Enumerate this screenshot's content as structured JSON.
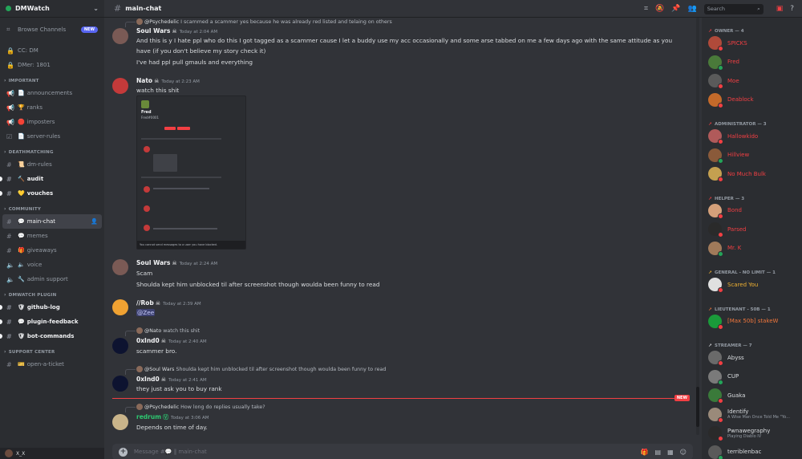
{
  "server": {
    "name": "DMWatch"
  },
  "sidebar": {
    "browse": {
      "label": "Browse Channels",
      "badge": "NEW"
    },
    "top_channels": [
      "CC: DM",
      "DMer: 1801"
    ],
    "categories": [
      {
        "name": "IMPORTANT",
        "channels": [
          {
            "label": "announcements",
            "emoji": "📄"
          },
          {
            "label": "ranks",
            "emoji": "🏆"
          },
          {
            "label": "imposters",
            "emoji": "🛑"
          },
          {
            "label": "server-rules",
            "emoji": "📄"
          }
        ]
      },
      {
        "name": "DEATHMATCHING",
        "channels": [
          {
            "label": "dm-rules",
            "emoji": "📜"
          },
          {
            "label": "audit",
            "emoji": "🔨"
          },
          {
            "label": "vouches",
            "emoji": "💛"
          }
        ]
      },
      {
        "name": "COMMUNITY",
        "channels": [
          {
            "label": "main-chat",
            "emoji": "💬"
          },
          {
            "label": "memes",
            "emoji": "💬"
          },
          {
            "label": "giveaways",
            "emoji": "🎁"
          },
          {
            "label": "voice",
            "emoji": "🔈"
          },
          {
            "label": "admin support",
            "emoji": "🔧"
          }
        ]
      },
      {
        "name": "DMWATCH PLUGIN",
        "channels": [
          {
            "label": "github-log",
            "emoji": "🛡"
          },
          {
            "label": "plugin-feedback",
            "emoji": "💬"
          },
          {
            "label": "bot-commands",
            "emoji": "🛡"
          }
        ]
      },
      {
        "name": "SUPPORT CENTER",
        "channels": [
          {
            "label": "open-a-ticket",
            "emoji": "🎫"
          }
        ]
      }
    ],
    "user": {
      "name": "X_X"
    }
  },
  "topbar": {
    "channel": "main-chat",
    "search_placeholder": "Search"
  },
  "messages": {
    "m1": {
      "reply_user": "@Psychedelic",
      "reply_text": "I scammed a scammer yes because he was already red listed and telaing on others",
      "author": "Soul Wars",
      "time": "Today at 2:04 AM",
      "lines": [
        "And this is y I hate ppl who do this I got tagged as a scammer cause I let a buddy use my acc occasionally and some arse tabbed on me a few days ago with the same attitude as you",
        "have (if you don't believe my story check it)",
        "I've had ppl pull gmauls and everything"
      ]
    },
    "m2": {
      "author": "Nato",
      "time": "Today at 2:23 AM",
      "text": "watch this shit",
      "embed": {
        "name1": "Fred",
        "name2": "Fred#0001",
        "foot": "You cannot send messages to a user you have blocked."
      }
    },
    "m3": {
      "author": "Soul Wars",
      "time": "Today at 2:24 AM",
      "lines": [
        "Scam",
        "Shoulda kept him unblocked til after screenshot though woulda been funny to read"
      ]
    },
    "m4": {
      "author": "//Rob",
      "time": "Today at 2:39 AM",
      "mention": "@Zee"
    },
    "m5": {
      "reply_user": "@Nato",
      "reply_text": "watch this shit",
      "author": "0xInd0",
      "time": "Today at 2:40 AM",
      "text": "scammer bro."
    },
    "m6": {
      "reply_user": "@Soul Wars",
      "reply_text": "Shoulda kept him unblocked til after screenshot though woulda been funny to read",
      "author": "0xInd0",
      "time": "Today at 2:41 AM",
      "text": "they just ask you to buy rank"
    },
    "divider_label": "NEW",
    "m7": {
      "reply_user": "@Psychedelic",
      "reply_text": "How long do replies usually take?",
      "author": "redrum",
      "time": "Today at 3:06 AM",
      "text": "Depends on time of day."
    }
  },
  "composer": {
    "placeholder": "Message #💬 ‖ main-chat"
  },
  "members": {
    "roles": [
      {
        "title": "OWNER — 4",
        "color": "#f23f43",
        "items": [
          {
            "name": "SPICKS",
            "color": "#f23f43"
          },
          {
            "name": "Fred",
            "color": "#f23f43"
          },
          {
            "name": "Moe",
            "color": "#f23f43"
          },
          {
            "name": "Deablock",
            "color": "#f23f43"
          }
        ]
      },
      {
        "title": "ADMINISTRATOR — 3",
        "color": "#f23f43",
        "items": [
          {
            "name": "Hallowkido",
            "color": "#f23f43"
          },
          {
            "name": "Hillview",
            "color": "#f23f43"
          },
          {
            "name": "No Much Bulk",
            "color": "#f23f43"
          }
        ]
      },
      {
        "title": "HELPER — 3",
        "color": "#f23f43",
        "items": [
          {
            "name": "Bond",
            "color": "#f23f43"
          },
          {
            "name": "Parsed",
            "color": "#f23f43"
          },
          {
            "name": "Mr. K",
            "color": "#f23f43"
          }
        ]
      },
      {
        "title": "GENERAL - NO LIMIT — 1",
        "color": "#f0b232",
        "items": [
          {
            "name": "Scared You",
            "color": "#f0b232"
          }
        ]
      },
      {
        "title": "LIEUTENANT - 50B — 1",
        "color": "#f0763c",
        "items": [
          {
            "name": "[Max 50b] stakeW",
            "color": "#f0763c"
          }
        ]
      },
      {
        "title": "STREAMER — 7",
        "color": "#dbdee1",
        "items": [
          {
            "name": "Abyss",
            "color": "#dbdee1"
          },
          {
            "name": "CUP",
            "color": "#dbdee1"
          },
          {
            "name": "Guaka",
            "color": "#dbdee1"
          },
          {
            "name": "Identify",
            "color": "#dbdee1",
            "activity": "A Wise Man Once Told Me \"Yo..."
          },
          {
            "name": "Pwnawegraphy",
            "color": "#dbdee1",
            "activity": "Playing Diablo IV"
          },
          {
            "name": "terriblenbac",
            "color": "#dbdee1"
          }
        ]
      }
    ]
  }
}
